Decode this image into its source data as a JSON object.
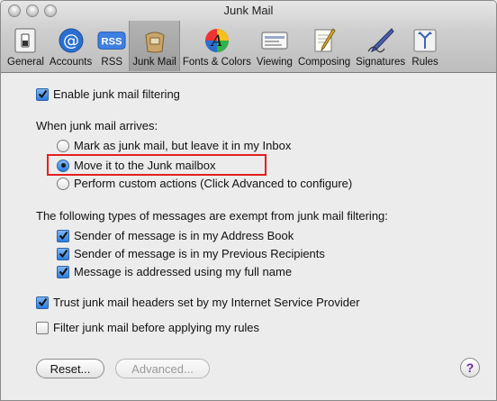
{
  "window": {
    "title": "Junk Mail"
  },
  "toolbar": {
    "items": [
      {
        "label": "General",
        "icon": "switch-icon"
      },
      {
        "label": "Accounts",
        "icon": "at-icon"
      },
      {
        "label": "RSS",
        "icon": "rss-icon"
      },
      {
        "label": "Junk Mail",
        "icon": "junk-bag-icon",
        "active": true
      },
      {
        "label": "Fonts & Colors",
        "icon": "font-color-icon"
      },
      {
        "label": "Viewing",
        "icon": "viewing-icon"
      },
      {
        "label": "Composing",
        "icon": "composing-icon"
      },
      {
        "label": "Signatures",
        "icon": "signature-pen-icon"
      },
      {
        "label": "Rules",
        "icon": "rules-icon"
      }
    ]
  },
  "junk": {
    "enable_label": "Enable junk mail filtering",
    "enable_checked": true,
    "arrives_heading": "When junk mail arrives:",
    "options": [
      "Mark as junk mail, but leave it in my Inbox",
      "Move it to the Junk mailbox",
      "Perform custom actions (Click Advanced to configure)"
    ],
    "selected_option": 1,
    "exempt_heading": "The following types of messages are exempt from junk mail filtering:",
    "exempt": [
      "Sender of message is in my Address Book",
      "Sender of message is in my Previous Recipients",
      "Message is addressed using my full name"
    ],
    "trust_label": "Trust junk mail headers set by my Internet Service Provider",
    "trust_checked": true,
    "filter_label": "Filter junk mail before applying my rules",
    "filter_checked": false,
    "reset_label": "Reset...",
    "advanced_label": "Advanced...",
    "help_label": "?"
  },
  "colors": {
    "accent": "#2d7ee0",
    "highlight": "#e32020"
  }
}
